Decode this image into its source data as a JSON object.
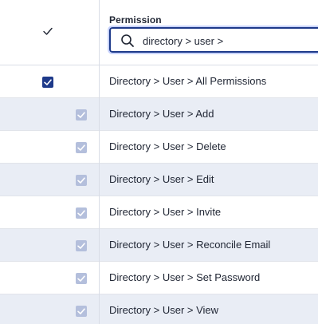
{
  "header": {
    "permission_title": "Permission",
    "search": {
      "value": "directory > user >",
      "placeholder": ""
    }
  },
  "rows": [
    {
      "label": "Directory > User > All Permissions",
      "checked": true,
      "inherited": false
    },
    {
      "label": "Directory > User > Add",
      "checked": true,
      "inherited": true
    },
    {
      "label": "Directory > User > Delete",
      "checked": true,
      "inherited": true
    },
    {
      "label": "Directory > User > Edit",
      "checked": true,
      "inherited": true
    },
    {
      "label": "Directory > User > Invite",
      "checked": true,
      "inherited": true
    },
    {
      "label": "Directory > User > Reconcile Email",
      "checked": true,
      "inherited": true
    },
    {
      "label": "Directory > User > Set Password",
      "checked": true,
      "inherited": true
    },
    {
      "label": "Directory > User > View",
      "checked": true,
      "inherited": true
    }
  ],
  "colors": {
    "accent": "#1e3a8a",
    "inherited_check": "#b4bfdc",
    "alt_row": "#e9edf5"
  }
}
